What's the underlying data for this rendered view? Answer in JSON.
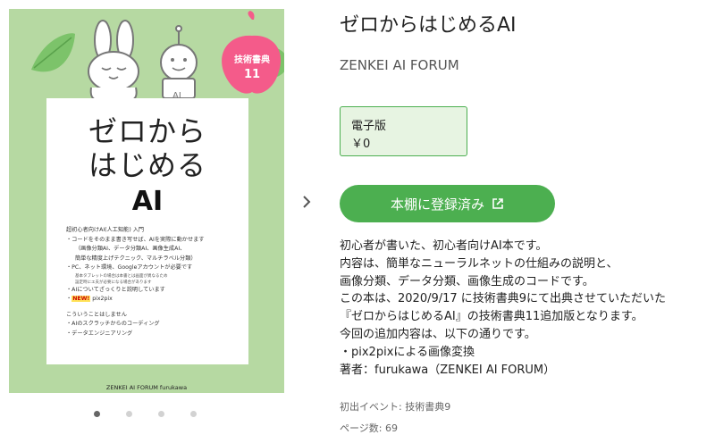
{
  "cover": {
    "title_line1": "ゼロから",
    "title_line2": "はじめる",
    "title_ai": "AI",
    "badge_line1": "技術書典",
    "badge_line2": "11",
    "robot_label": "AI",
    "lines": [
      "超初心者向けAI(人工知能) 入門",
      "・コードをそのまま書き写せば、AIを実際に動かせます",
      "（画像分類AI、データ分類AI、画像生成AI、",
      "簡単な精度上げテクニック、マルチラベル分類）",
      "・PC、ネット環境、Googleアカウントが必要です",
      "基本タブレットの場合は本書とは画面が異なるため",
      "設定時にエ夫が必要になる場合があります",
      "・AIについてざっくりと説明しています",
      "NEW!",
      "pix2pix",
      "こういうことはしません",
      "・AIのスクラッチからのコーディング",
      "・データエンジニアリング"
    ],
    "footer": "ZENKEI AI FORUM    furukawa"
  },
  "carousel": {
    "dot_count": 4,
    "active_index": 0
  },
  "book": {
    "title": "ゼロからはじめるAI",
    "publisher": "ZENKEI AI FORUM",
    "edition_label": "電子版",
    "price": "￥0",
    "shelf_button": "本棚に登録済み",
    "description": [
      "初心者が書いた、初心者向けAI本です。",
      "内容は、簡単なニューラルネットの仕組みの説明と、",
      "画像分類、データ分類、画像生成のコードです。",
      "この本は、2020/9/17 に技術書典9にて出典させていただいた",
      "『ゼロからはじめるAI』の技術書典11追加版となります。",
      "今回の追加内容は、以下の通りです。",
      "・pix2pixによる画像変換",
      "著者：furukawa（ZENKEI AI FORUM）"
    ],
    "event": "初出イベント: 技術書典9",
    "pages": "ページ数: 69"
  },
  "colors": {
    "accent": "#4caf50",
    "cover_bg": "#b6d9a2",
    "badge": "#f45b8a"
  }
}
